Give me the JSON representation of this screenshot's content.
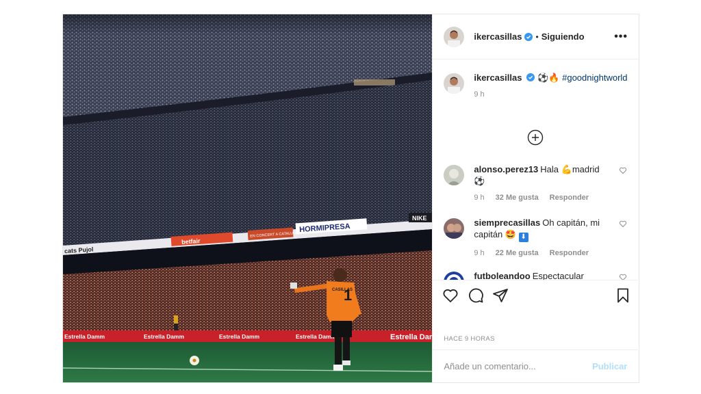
{
  "header": {
    "username": "ikercasillas",
    "separator": "•",
    "follow_status": "Siguiendo",
    "more_icon": "more-options-icon"
  },
  "caption": {
    "username": "ikercasillas",
    "emojis": "⚽🔥",
    "hashtag": "#goodnightworld",
    "time": "9 h"
  },
  "comments": [
    {
      "username": "alonso.perez13",
      "text_before": "Hala ",
      "emoji": "💪",
      "text_after": "madrid",
      "text_line2": "⚽",
      "time": "9 h",
      "likes": "32 Me gusta",
      "reply": "Responder"
    },
    {
      "username": "siemprecasillas",
      "text": "Oh capitán, mi capitán 🤩",
      "emoji_badge": "⬇",
      "time": "9 h",
      "likes": "22 Me gusta",
      "reply": "Responder"
    },
    {
      "username": "futboleandoo",
      "text": "Espectacular"
    }
  ],
  "footer": {
    "time_ago": "HACE 9 HORAS",
    "comment_placeholder": "Añade un comentario...",
    "publish_label": "Publicar"
  },
  "photo": {
    "banners": {
      "upper_left": "cats Pujol",
      "betfair": "betfair",
      "hormipresa": "HORMIPRESA",
      "nike": "NIKE",
      "estrella": "Estrella Damm",
      "catalunya": "EN CONCERT A CATALUNYA"
    },
    "jersey_number": "1",
    "jersey_name": "CASILLAS"
  },
  "colors": {
    "verified": "#3897f0",
    "hashtag": "#00376b",
    "publish_disabled": "#b2dffc",
    "border": "#efefef"
  }
}
